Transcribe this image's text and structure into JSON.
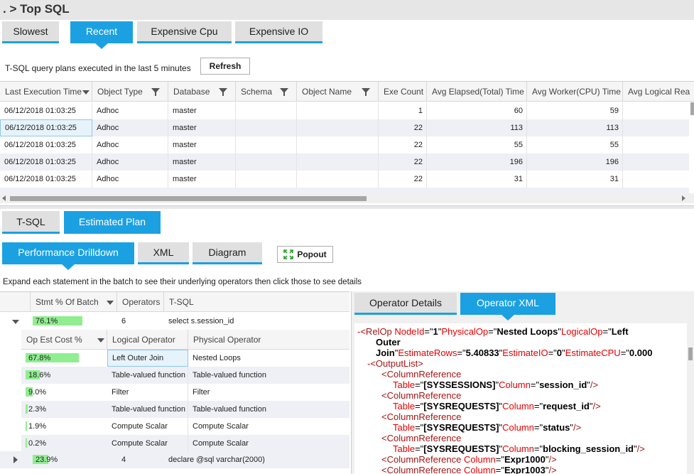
{
  "breadcrumb": ". > Top SQL",
  "top_tabs": [
    "Slowest",
    "Recent",
    "Expensive Cpu",
    "Expensive IO"
  ],
  "caption": "T-SQL query plans executed in the last 5 minutes",
  "refresh_label": "Refresh",
  "grid": {
    "columns": [
      "Last Execution Time",
      "Object Type",
      "Database",
      "Schema",
      "Object Name",
      "Exe Count",
      "Avg Elapsed(Total) Time",
      "Avg Worker(CPU) Time",
      "Avg Logical Rea"
    ],
    "rows": [
      [
        "06/12/2018 01:03:25",
        "Adhoc",
        "master",
        "",
        "",
        "1",
        "60",
        "59"
      ],
      [
        "06/12/2018 01:03:25",
        "Adhoc",
        "master",
        "",
        "",
        "22",
        "113",
        "113"
      ],
      [
        "06/12/2018 01:03:25",
        "Adhoc",
        "master",
        "",
        "",
        "22",
        "55",
        "55"
      ],
      [
        "06/12/2018 01:03:25",
        "Adhoc",
        "master",
        "",
        "",
        "22",
        "196",
        "196"
      ],
      [
        "06/12/2018 01:03:25",
        "Adhoc",
        "master",
        "",
        "",
        "22",
        "31",
        "31"
      ]
    ]
  },
  "mid_tabs": [
    "T-SQL",
    "Estimated Plan"
  ],
  "plan_tabs": [
    "Performance Drilldown",
    "XML",
    "Diagram"
  ],
  "popout_label": "Popout",
  "drilldown_caption": "Expand each statement in the batch to see their underlying operators then click those to see details",
  "drilldown": {
    "columns": [
      "Stmt % Of Batch",
      "Operators",
      "T-SQL"
    ],
    "statements": [
      {
        "pct": "76.1%",
        "pct_value": 76.1,
        "operators": "6",
        "tsql": "select s.session_id"
      },
      {
        "pct": "23.9%",
        "pct_value": 23.9,
        "operators": "4",
        "tsql": "declare @sql varchar(2000)"
      }
    ],
    "op_columns": [
      "Op Est Cost %",
      "Logical Operator",
      "Physical Operator"
    ],
    "operators": [
      {
        "pct": "67.8%",
        "pct_value": 67.8,
        "logical": "Left Outer Join",
        "physical": "Nested Loops"
      },
      {
        "pct": "18.6%",
        "pct_value": 18.6,
        "logical": "Table-valued function",
        "physical": "Table-valued function"
      },
      {
        "pct": "9.0%",
        "pct_value": 9.0,
        "logical": "Filter",
        "physical": "Filter"
      },
      {
        "pct": "2.3%",
        "pct_value": 2.3,
        "logical": "Table-valued function",
        "physical": "Table-valued function"
      },
      {
        "pct": "1.9%",
        "pct_value": 1.9,
        "logical": "Compute Scalar",
        "physical": "Compute Scalar"
      },
      {
        "pct": "0.2%",
        "pct_value": 0.2,
        "logical": "Compute Scalar",
        "physical": "Compute Scalar"
      }
    ]
  },
  "detail_tabs": [
    "Operator Details",
    "Operator XML"
  ],
  "xml": {
    "relop_nodeid": "1",
    "relop_physical": "Nested Loops",
    "relop_logical_1": "Left",
    "relop_logical_2": "Outer",
    "relop_logical_3": "Join",
    "estimate_rows": "5.40833",
    "estimate_io": "0",
    "estimate_cpu": "0.000",
    "colrefs": [
      {
        "table": "[SYSSESSIONS]",
        "column": "session_id"
      },
      {
        "table": "[SYSREQUESTS]",
        "column": "request_id"
      },
      {
        "table": "[SYSREQUESTS]",
        "column": "status"
      },
      {
        "table": "[SYSREQUESTS]",
        "column": "blocking_session_id"
      }
    ],
    "expr_columns": [
      "Expr1000",
      "Expr1003"
    ]
  },
  "colors": {
    "accent": "#1ba1e2",
    "bar": "#90ee90",
    "selected_row": "#e6f3fb"
  }
}
